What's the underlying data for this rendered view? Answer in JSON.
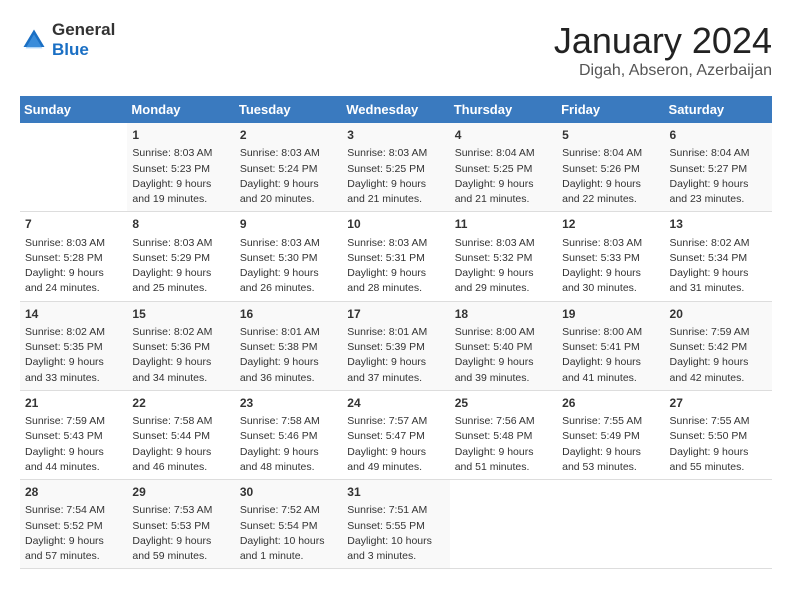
{
  "header": {
    "logo_line1": "General",
    "logo_line2": "Blue",
    "month": "January 2024",
    "location": "Digah, Abseron, Azerbaijan"
  },
  "days_of_week": [
    "Sunday",
    "Monday",
    "Tuesday",
    "Wednesday",
    "Thursday",
    "Friday",
    "Saturday"
  ],
  "weeks": [
    [
      {
        "day": "",
        "sunrise": "",
        "sunset": "",
        "daylight": ""
      },
      {
        "day": "1",
        "sunrise": "Sunrise: 8:03 AM",
        "sunset": "Sunset: 5:23 PM",
        "daylight": "Daylight: 9 hours and 19 minutes."
      },
      {
        "day": "2",
        "sunrise": "Sunrise: 8:03 AM",
        "sunset": "Sunset: 5:24 PM",
        "daylight": "Daylight: 9 hours and 20 minutes."
      },
      {
        "day": "3",
        "sunrise": "Sunrise: 8:03 AM",
        "sunset": "Sunset: 5:25 PM",
        "daylight": "Daylight: 9 hours and 21 minutes."
      },
      {
        "day": "4",
        "sunrise": "Sunrise: 8:04 AM",
        "sunset": "Sunset: 5:25 PM",
        "daylight": "Daylight: 9 hours and 21 minutes."
      },
      {
        "day": "5",
        "sunrise": "Sunrise: 8:04 AM",
        "sunset": "Sunset: 5:26 PM",
        "daylight": "Daylight: 9 hours and 22 minutes."
      },
      {
        "day": "6",
        "sunrise": "Sunrise: 8:04 AM",
        "sunset": "Sunset: 5:27 PM",
        "daylight": "Daylight: 9 hours and 23 minutes."
      }
    ],
    [
      {
        "day": "7",
        "sunrise": "Sunrise: 8:03 AM",
        "sunset": "Sunset: 5:28 PM",
        "daylight": "Daylight: 9 hours and 24 minutes."
      },
      {
        "day": "8",
        "sunrise": "Sunrise: 8:03 AM",
        "sunset": "Sunset: 5:29 PM",
        "daylight": "Daylight: 9 hours and 25 minutes."
      },
      {
        "day": "9",
        "sunrise": "Sunrise: 8:03 AM",
        "sunset": "Sunset: 5:30 PM",
        "daylight": "Daylight: 9 hours and 26 minutes."
      },
      {
        "day": "10",
        "sunrise": "Sunrise: 8:03 AM",
        "sunset": "Sunset: 5:31 PM",
        "daylight": "Daylight: 9 hours and 28 minutes."
      },
      {
        "day": "11",
        "sunrise": "Sunrise: 8:03 AM",
        "sunset": "Sunset: 5:32 PM",
        "daylight": "Daylight: 9 hours and 29 minutes."
      },
      {
        "day": "12",
        "sunrise": "Sunrise: 8:03 AM",
        "sunset": "Sunset: 5:33 PM",
        "daylight": "Daylight: 9 hours and 30 minutes."
      },
      {
        "day": "13",
        "sunrise": "Sunrise: 8:02 AM",
        "sunset": "Sunset: 5:34 PM",
        "daylight": "Daylight: 9 hours and 31 minutes."
      }
    ],
    [
      {
        "day": "14",
        "sunrise": "Sunrise: 8:02 AM",
        "sunset": "Sunset: 5:35 PM",
        "daylight": "Daylight: 9 hours and 33 minutes."
      },
      {
        "day": "15",
        "sunrise": "Sunrise: 8:02 AM",
        "sunset": "Sunset: 5:36 PM",
        "daylight": "Daylight: 9 hours and 34 minutes."
      },
      {
        "day": "16",
        "sunrise": "Sunrise: 8:01 AM",
        "sunset": "Sunset: 5:38 PM",
        "daylight": "Daylight: 9 hours and 36 minutes."
      },
      {
        "day": "17",
        "sunrise": "Sunrise: 8:01 AM",
        "sunset": "Sunset: 5:39 PM",
        "daylight": "Daylight: 9 hours and 37 minutes."
      },
      {
        "day": "18",
        "sunrise": "Sunrise: 8:00 AM",
        "sunset": "Sunset: 5:40 PM",
        "daylight": "Daylight: 9 hours and 39 minutes."
      },
      {
        "day": "19",
        "sunrise": "Sunrise: 8:00 AM",
        "sunset": "Sunset: 5:41 PM",
        "daylight": "Daylight: 9 hours and 41 minutes."
      },
      {
        "day": "20",
        "sunrise": "Sunrise: 7:59 AM",
        "sunset": "Sunset: 5:42 PM",
        "daylight": "Daylight: 9 hours and 42 minutes."
      }
    ],
    [
      {
        "day": "21",
        "sunrise": "Sunrise: 7:59 AM",
        "sunset": "Sunset: 5:43 PM",
        "daylight": "Daylight: 9 hours and 44 minutes."
      },
      {
        "day": "22",
        "sunrise": "Sunrise: 7:58 AM",
        "sunset": "Sunset: 5:44 PM",
        "daylight": "Daylight: 9 hours and 46 minutes."
      },
      {
        "day": "23",
        "sunrise": "Sunrise: 7:58 AM",
        "sunset": "Sunset: 5:46 PM",
        "daylight": "Daylight: 9 hours and 48 minutes."
      },
      {
        "day": "24",
        "sunrise": "Sunrise: 7:57 AM",
        "sunset": "Sunset: 5:47 PM",
        "daylight": "Daylight: 9 hours and 49 minutes."
      },
      {
        "day": "25",
        "sunrise": "Sunrise: 7:56 AM",
        "sunset": "Sunset: 5:48 PM",
        "daylight": "Daylight: 9 hours and 51 minutes."
      },
      {
        "day": "26",
        "sunrise": "Sunrise: 7:55 AM",
        "sunset": "Sunset: 5:49 PM",
        "daylight": "Daylight: 9 hours and 53 minutes."
      },
      {
        "day": "27",
        "sunrise": "Sunrise: 7:55 AM",
        "sunset": "Sunset: 5:50 PM",
        "daylight": "Daylight: 9 hours and 55 minutes."
      }
    ],
    [
      {
        "day": "28",
        "sunrise": "Sunrise: 7:54 AM",
        "sunset": "Sunset: 5:52 PM",
        "daylight": "Daylight: 9 hours and 57 minutes."
      },
      {
        "day": "29",
        "sunrise": "Sunrise: 7:53 AM",
        "sunset": "Sunset: 5:53 PM",
        "daylight": "Daylight: 9 hours and 59 minutes."
      },
      {
        "day": "30",
        "sunrise": "Sunrise: 7:52 AM",
        "sunset": "Sunset: 5:54 PM",
        "daylight": "Daylight: 10 hours and 1 minute."
      },
      {
        "day": "31",
        "sunrise": "Sunrise: 7:51 AM",
        "sunset": "Sunset: 5:55 PM",
        "daylight": "Daylight: 10 hours and 3 minutes."
      },
      {
        "day": "",
        "sunrise": "",
        "sunset": "",
        "daylight": ""
      },
      {
        "day": "",
        "sunrise": "",
        "sunset": "",
        "daylight": ""
      },
      {
        "day": "",
        "sunrise": "",
        "sunset": "",
        "daylight": ""
      }
    ]
  ]
}
